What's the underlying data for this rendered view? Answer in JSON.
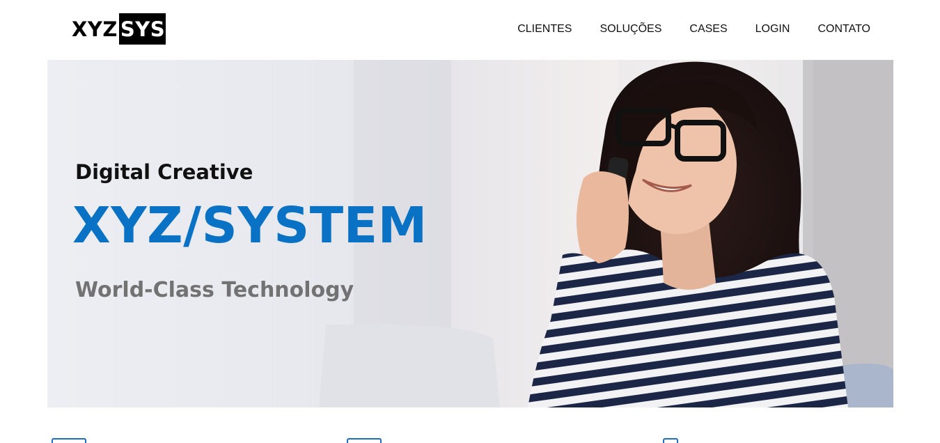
{
  "header": {
    "logo": {
      "left": "XYZ",
      "right": "SYS"
    },
    "nav": [
      "CLIENTES",
      "SOLUÇÕES",
      "CASES",
      "LOGIN",
      "CONTATO"
    ]
  },
  "hero": {
    "kicker": "Digital Creative",
    "headline": "XYZ/SYSTEM",
    "tagline": "World-Class Technology",
    "headline_color": "#0a72c5",
    "tagline_color": "#727272"
  },
  "features": {
    "icons": [
      "feature-icon",
      "feature-icon",
      "feature-icon"
    ]
  }
}
